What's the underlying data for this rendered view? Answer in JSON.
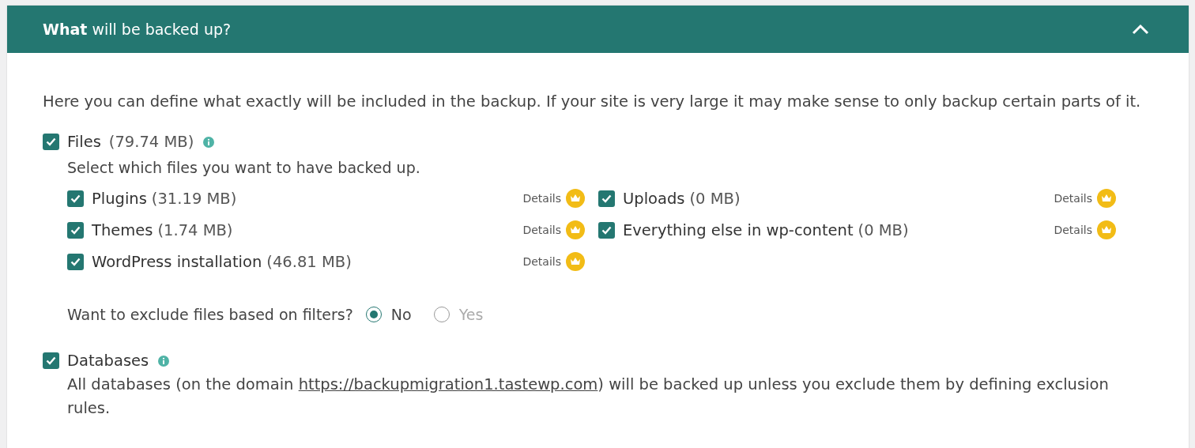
{
  "panel": {
    "title": "**What** will be backed up?",
    "expanded": true
  },
  "intro": "Here you can define what exactly will be included in the backup. If your site is very large it may make sense to only backup certain parts of it.",
  "files": {
    "label": "Files",
    "size": "(79.74 MB)",
    "checked": true,
    "hint": "Select which files you want to have backed up.",
    "items": [
      {
        "label": "Plugins",
        "size": "(31.19 MB)",
        "checked": true,
        "details": "Details"
      },
      {
        "label": "Themes",
        "size": "(1.74 MB)",
        "checked": true,
        "details": "Details"
      },
      {
        "label": "WordPress installation",
        "size": "(46.81 MB)",
        "checked": true,
        "details": "Details"
      },
      {
        "label": "Uploads",
        "size": "(0 MB)",
        "checked": true,
        "details": "Details"
      },
      {
        "label": "Everything else in wp-content",
        "size": "(0 MB)",
        "checked": true,
        "details": "Details"
      }
    ],
    "filter": {
      "question": "Want to exclude files based on filters?",
      "options": [
        {
          "label": "No",
          "selected": true
        },
        {
          "label": "Yes",
          "selected": false
        }
      ]
    }
  },
  "databases": {
    "label": "Databases",
    "checked": true,
    "text_before": "All databases (on the domain ",
    "link": "https://backupmigration1.tastewp.com",
    "text_after": ") will be backed up unless you exclude them by defining exclusion rules."
  }
}
